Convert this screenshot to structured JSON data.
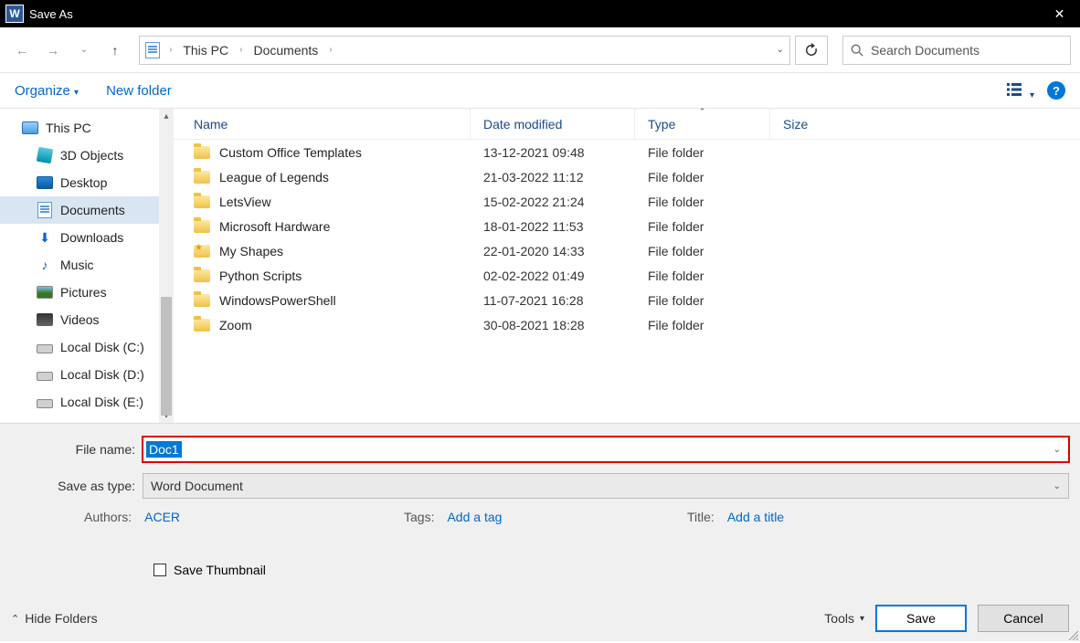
{
  "titlebar": {
    "title": "Save As"
  },
  "breadcrumbs": {
    "root_icon": "document",
    "this_pc": "This PC",
    "documents": "Documents"
  },
  "search": {
    "placeholder": "Search Documents"
  },
  "toolbar": {
    "organize": "Organize",
    "new_folder": "New folder"
  },
  "sidebar": [
    {
      "icon": "pc",
      "label": "This PC",
      "sel": false
    },
    {
      "icon": "obj3d",
      "label": "3D Objects",
      "sel": false
    },
    {
      "icon": "desktop",
      "label": "Desktop",
      "sel": false
    },
    {
      "icon": "doc",
      "label": "Documents",
      "sel": true
    },
    {
      "icon": "dl",
      "label": "Downloads",
      "sel": false
    },
    {
      "icon": "music",
      "label": "Music",
      "sel": false
    },
    {
      "icon": "pic",
      "label": "Pictures",
      "sel": false
    },
    {
      "icon": "video",
      "label": "Videos",
      "sel": false
    },
    {
      "icon": "disk",
      "label": "Local Disk (C:)",
      "sel": false
    },
    {
      "icon": "disk",
      "label": "Local Disk (D:)",
      "sel": false
    },
    {
      "icon": "disk",
      "label": "Local Disk (E:)",
      "sel": false
    }
  ],
  "columns": {
    "name": "Name",
    "date": "Date modified",
    "type": "Type",
    "size": "Size"
  },
  "files": [
    {
      "name": "Custom Office Templates",
      "date": "13-12-2021 09:48",
      "type": "File folder",
      "icon": "folder"
    },
    {
      "name": "League of Legends",
      "date": "21-03-2022 11:12",
      "type": "File folder",
      "icon": "folder"
    },
    {
      "name": "LetsView",
      "date": "15-02-2022 21:24",
      "type": "File folder",
      "icon": "folder"
    },
    {
      "name": "Microsoft Hardware",
      "date": "18-01-2022 11:53",
      "type": "File folder",
      "icon": "folder"
    },
    {
      "name": "My Shapes",
      "date": "22-01-2020 14:33",
      "type": "File folder",
      "icon": "star"
    },
    {
      "name": "Python Scripts",
      "date": "02-02-2022 01:49",
      "type": "File folder",
      "icon": "folder"
    },
    {
      "name": "WindowsPowerShell",
      "date": "11-07-2021 16:28",
      "type": "File folder",
      "icon": "folder"
    },
    {
      "name": "Zoom",
      "date": "30-08-2021 18:28",
      "type": "File folder",
      "icon": "folder"
    }
  ],
  "form": {
    "filename_label": "File name:",
    "filename_value": "Doc1",
    "type_label": "Save as type:",
    "type_value": "Word Document",
    "authors_label": "Authors:",
    "authors_value": "ACER",
    "tags_label": "Tags:",
    "tags_value": "Add a tag",
    "title_label": "Title:",
    "title_value": "Add a title",
    "thumbnail_label": "Save Thumbnail"
  },
  "footer": {
    "hide_folders": "Hide Folders",
    "tools": "Tools",
    "save": "Save",
    "cancel": "Cancel"
  }
}
